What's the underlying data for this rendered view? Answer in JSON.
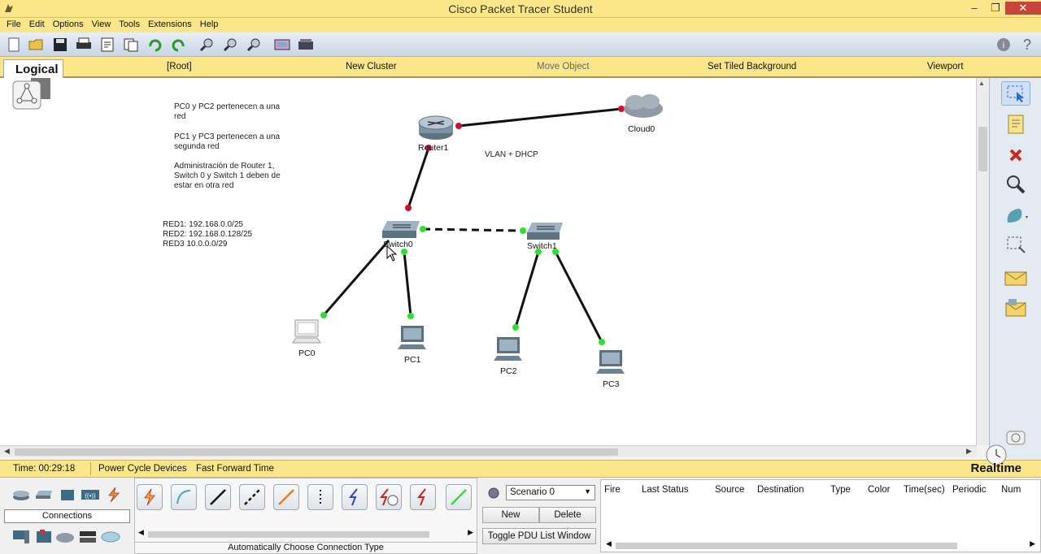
{
  "window": {
    "title": "Cisco Packet Tracer Student",
    "min": "–",
    "restore": "❐",
    "close": "✕"
  },
  "menu": [
    "File",
    "Edit",
    "Options",
    "View",
    "Tools",
    "Extensions",
    "Help"
  ],
  "logicalbar": {
    "tab": "Logical",
    "root": "[Root]",
    "new_cluster": "New Cluster",
    "move_object": "Move Object",
    "tiled_bg": "Set Tiled Background",
    "viewport": "Viewport"
  },
  "notes": {
    "n1a": "PC0 y PC2 pertenecen a una",
    "n1b": "red",
    "n2a": "PC1 y PC3 pertenecen a una",
    "n2b": "segunda red",
    "n3a": "Administración de Router 1,",
    "n3b": "Switch 0 y Switch 1 deben de",
    "n3c": "estar en otra red",
    "r1": "RED1: 192.168.0.0/25",
    "r2": "RED2: 192.168.0.128/25",
    "r3": "RED3 10.0.0.0/29",
    "vlan": "VLAN + DHCP"
  },
  "devices": {
    "router": "Router1",
    "cloud": "Cloud0",
    "sw0": "Switch0",
    "sw1": "Switch1",
    "pc0": "PC0",
    "pc1": "PC1",
    "pc2": "PC2",
    "pc3": "PC3"
  },
  "status": {
    "time": "Time: 00:29:18",
    "power": "Power Cycle Devices",
    "ff": "Fast Forward Time",
    "mode": "Realtime"
  },
  "bottom": {
    "connections": "Connections",
    "auto_conn": "Automatically Choose Connection Type",
    "scenario": "Scenario 0",
    "new": "New",
    "delete": "Delete",
    "toggle": "Toggle PDU List Window",
    "pdu_headers": [
      "Fire",
      "Last Status",
      "Source",
      "Destination",
      "Type",
      "Color",
      "Time(sec)",
      "Periodic",
      "Num"
    ]
  }
}
